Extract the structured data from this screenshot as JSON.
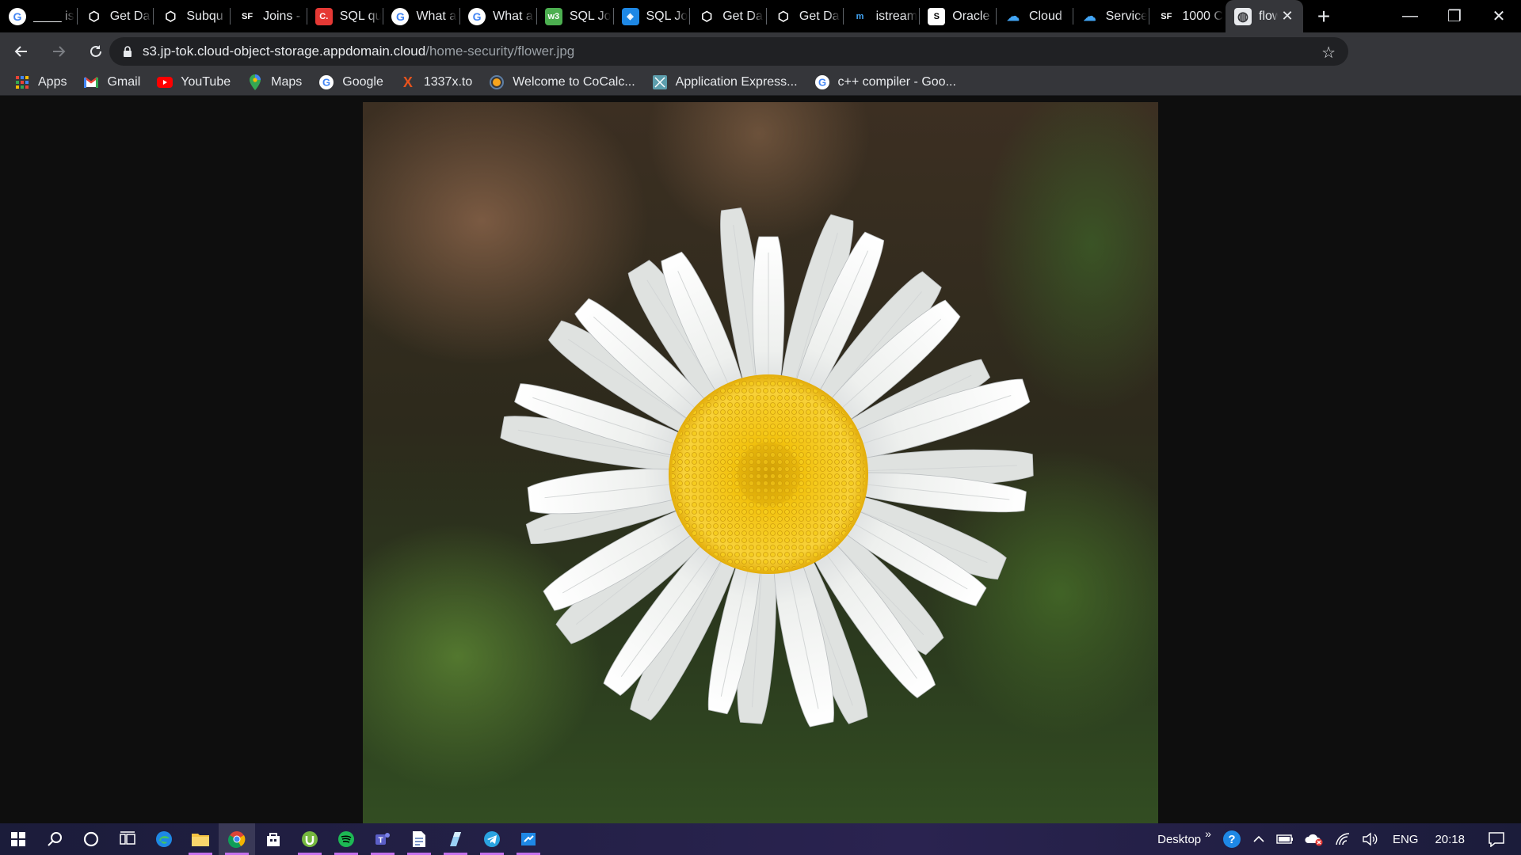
{
  "tabs": [
    {
      "title": "____ is",
      "icon": "google-icon"
    },
    {
      "title": "Get Da",
      "icon": "hackerrank-icon"
    },
    {
      "title": "Subqu",
      "icon": "hackerrank-icon"
    },
    {
      "title": "Joins -",
      "icon": "sf-icon",
      "icon_text": "SF"
    },
    {
      "title": "SQL qu",
      "icon": "c-icon",
      "icon_text": "C."
    },
    {
      "title": "What a",
      "icon": "google-icon"
    },
    {
      "title": "What a",
      "icon": "google-icon"
    },
    {
      "title": "SQL Jo",
      "icon": "w3-icon",
      "icon_text": "w3"
    },
    {
      "title": "SQL Jo",
      "icon": "shield-icon"
    },
    {
      "title": "Get Da",
      "icon": "hackerrank-icon"
    },
    {
      "title": "Get Da",
      "icon": "hackerrank-icon"
    },
    {
      "title": "istream",
      "icon": "m-icon",
      "icon_text": "m"
    },
    {
      "title": "Oracle",
      "icon": "oracle-icon",
      "icon_text": "S"
    },
    {
      "title": "Cloud",
      "icon": "cloud-icon"
    },
    {
      "title": "Service",
      "icon": "cloud-icon"
    },
    {
      "title": "1000 C",
      "icon": "sf-icon",
      "icon_text": "SF"
    },
    {
      "title": "flow",
      "icon": "globe-icon",
      "active": true
    }
  ],
  "window": {
    "minimize": "—",
    "restore": "❐",
    "close": "✕",
    "new_tab": "+"
  },
  "toolbar": {
    "url_host": "s3.jp-tok.cloud-object-storage.appdomain.cloud",
    "url_path": "/home-security/flower.jpg"
  },
  "bookmarks": [
    {
      "label": "Apps",
      "icon": "apps-grid-icon"
    },
    {
      "label": "Gmail",
      "icon": "gmail-icon"
    },
    {
      "label": "YouTube",
      "icon": "youtube-icon"
    },
    {
      "label": "Maps",
      "icon": "maps-pin-icon"
    },
    {
      "label": "Google",
      "icon": "google-icon"
    },
    {
      "label": "1337x.to",
      "icon": "x-icon"
    },
    {
      "label": "Welcome to CoCalc...",
      "icon": "cocalc-icon"
    },
    {
      "label": "Application Express...",
      "icon": "apex-icon"
    },
    {
      "label": "c++ compiler - Goo...",
      "icon": "google-icon"
    }
  ],
  "taskbar": {
    "desktop_label": "Desktop",
    "language": "ENG",
    "time": "20:18"
  },
  "colors": {
    "tabstrip": "#000000",
    "toolbar": "#35363a",
    "omnibox": "#202124",
    "petal": "#f4f5f2",
    "disc": "#f2c20f"
  }
}
